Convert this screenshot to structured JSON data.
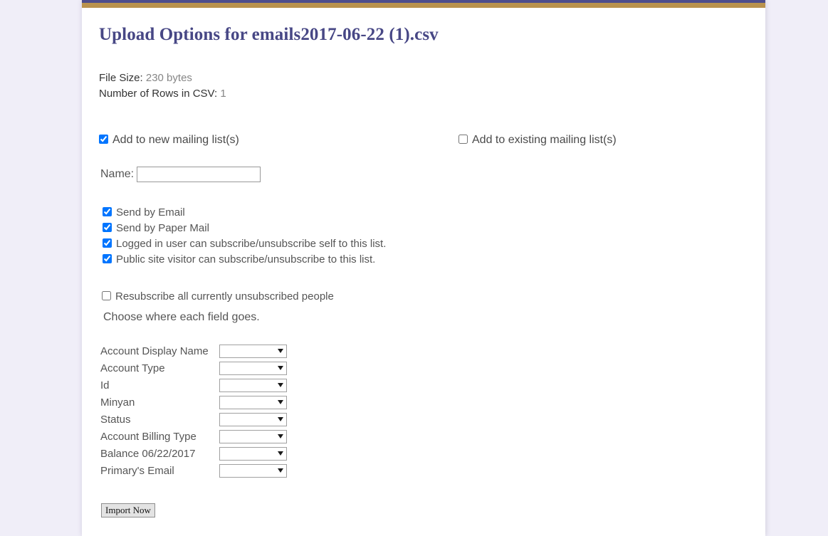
{
  "theme": {
    "page_background": "#f0eef8",
    "panel_background": "#ffffff",
    "accent_bar_top": "#4d4d8c",
    "accent_bar_gold": "#b9924d",
    "title_color": "#474785"
  },
  "header": {
    "title": "Upload Options for emails2017-06-22 (1).csv"
  },
  "file_meta": {
    "file_size_label": "File Size:",
    "file_size_value": "230 bytes",
    "rows_label": "Number of Rows in CSV:",
    "rows_value": "1"
  },
  "mailing_list": {
    "new_list_label": "Add to new mailing list(s)",
    "new_list_checked": true,
    "existing_list_label": "Add to existing mailing list(s)",
    "existing_list_checked": false,
    "name_label": "Name:",
    "name_value": "",
    "name_placeholder": ""
  },
  "list_options": [
    {
      "label": "Send by Email",
      "checked": true
    },
    {
      "label": "Send by Paper Mail",
      "checked": true
    },
    {
      "label": "Logged in user can subscribe/unsubscribe self to this list.",
      "checked": true
    },
    {
      "label": "Public site visitor can subscribe/unsubscribe to this list.",
      "checked": true
    }
  ],
  "resubscribe": {
    "label": "Resubscribe all currently unsubscribed people",
    "checked": false
  },
  "field_mapping": {
    "instructions": "Choose where each field goes.",
    "selected_option": "",
    "rows": [
      {
        "label": "Account Display Name",
        "value": ""
      },
      {
        "label": "Account Type",
        "value": ""
      },
      {
        "label": "Id",
        "value": ""
      },
      {
        "label": "Minyan",
        "value": ""
      },
      {
        "label": "Status",
        "value": ""
      },
      {
        "label": "Account Billing Type",
        "value": ""
      },
      {
        "label": "Balance 06/22/2017",
        "value": ""
      },
      {
        "label": "Primary's Email",
        "value": ""
      }
    ]
  },
  "actions": {
    "import_label": "Import Now"
  }
}
